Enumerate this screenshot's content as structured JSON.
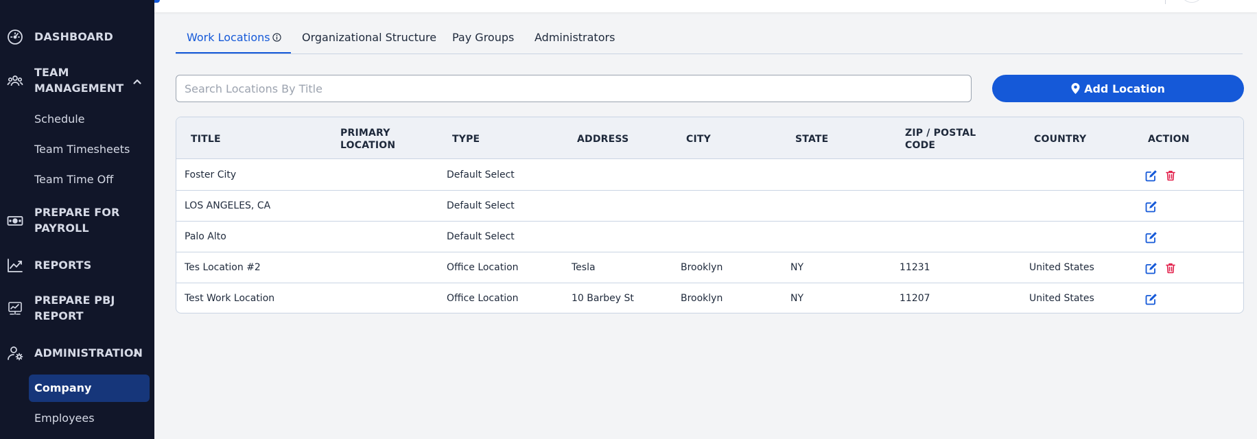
{
  "sidebar": {
    "items": [
      {
        "label": "DASHBOARD",
        "icon": "gauge-icon"
      },
      {
        "label": "TEAM MANAGEMENT",
        "icon": "users-icon",
        "expanded": true
      },
      {
        "label": "PREPARE FOR PAYROLL",
        "icon": "money-icon"
      },
      {
        "label": "REPORTS",
        "icon": "chart-line-icon"
      },
      {
        "label": "PREPARE PBJ REPORT",
        "icon": "report-chart-icon"
      },
      {
        "label": "ADMINISTRATION",
        "icon": "user-gear-icon",
        "expanded": true
      }
    ],
    "team_management_sub": [
      "Schedule",
      "Team Timesheets",
      "Team Time Off"
    ],
    "administration_sub": [
      "Company",
      "Employees"
    ],
    "active_sub": "Company"
  },
  "tabs": [
    {
      "label": "Work Locations",
      "active": true,
      "has_info": true
    },
    {
      "label": "Organizational Structure",
      "active": false
    },
    {
      "label": "Pay Groups",
      "active": false
    },
    {
      "label": "Administrators",
      "active": false
    }
  ],
  "search": {
    "placeholder": "Search Locations By Title",
    "value": ""
  },
  "add_button": {
    "label": "Add Location",
    "icon": "map-pin-icon"
  },
  "table": {
    "headers": [
      "TITLE",
      "PRIMARY LOCATION",
      "TYPE",
      "ADDRESS",
      "CITY",
      "STATE",
      "ZIP / POSTAL CODE",
      "COUNTRY",
      "ACTION"
    ],
    "rows": [
      {
        "title": "Foster City",
        "primary": "",
        "type": "Default Select",
        "address": "",
        "city": "",
        "state": "",
        "zip": "",
        "country": "",
        "can_delete": true
      },
      {
        "title": "LOS ANGELES, CA",
        "primary": "",
        "type": "Default Select",
        "address": "",
        "city": "",
        "state": "",
        "zip": "",
        "country": "",
        "can_delete": false
      },
      {
        "title": "Palo Alto",
        "primary": "",
        "type": "Default Select",
        "address": "",
        "city": "",
        "state": "",
        "zip": "",
        "country": "",
        "can_delete": false
      },
      {
        "title": "Tes Location #2",
        "primary": "",
        "type": "Office Location",
        "address": "Tesla",
        "city": "Brooklyn",
        "state": "NY",
        "zip": "11231",
        "country": "United States",
        "can_delete": true
      },
      {
        "title": "Test Work Location",
        "primary": "",
        "type": "Office Location",
        "address": "10 Barbey St",
        "city": "Brooklyn",
        "state": "NY",
        "zip": "11207",
        "country": "United States",
        "can_delete": false
      }
    ]
  },
  "colors": {
    "sidebar_bg": "#111629",
    "accent": "#1559d8",
    "active_sub_bg": "#16367a",
    "delete": "#e11d48"
  }
}
